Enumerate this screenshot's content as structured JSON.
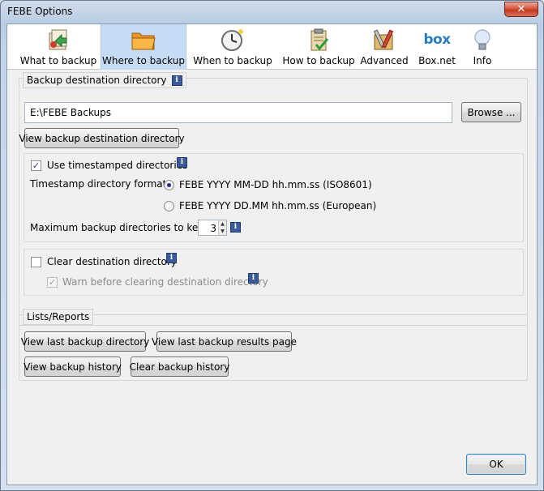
{
  "window": {
    "title": "FEBE Options",
    "close_glyph": "✕"
  },
  "tabs": [
    {
      "label": "What to backup",
      "icon": "backup-arrow-icon"
    },
    {
      "label": "Where to backup",
      "icon": "folder-icon",
      "active": true
    },
    {
      "label": "When to backup",
      "icon": "clock-icon"
    },
    {
      "label": "How to backup",
      "icon": "clipboard-check-icon"
    },
    {
      "label": "Advanced",
      "icon": "tools-icon"
    },
    {
      "label": "Box.net",
      "icon": "box-logo-icon",
      "logo_text": "box"
    },
    {
      "label": "Info",
      "icon": "lightbulb-icon"
    }
  ],
  "destination": {
    "legend": "Backup destination directory",
    "path_value": "E:\\FEBE Backups",
    "browse_label": "Browse ...",
    "view_label": "View backup destination directory",
    "info_glyph": "i"
  },
  "timestamp": {
    "use_label": "Use timestamped directories",
    "use_checked": true,
    "format_label": "Timestamp directory format:",
    "option_iso": "FEBE YYYY MM-DD hh.mm.ss (ISO8601)",
    "option_eu": "FEBE YYYY DD.MM hh.mm.ss (European)",
    "selected": "iso",
    "max_label": "Maximum backup directories to keep:",
    "max_value": "3"
  },
  "clear": {
    "clear_label": "Clear destination directory",
    "clear_checked": false,
    "warn_label": "Warn before clearing destination directory",
    "warn_checked": true,
    "warn_disabled": true
  },
  "lists": {
    "legend": "Lists/Reports",
    "view_last_dir": "View last backup directory",
    "view_last_results": "View last backup results page",
    "view_history": "View backup history",
    "clear_history": "Clear backup history"
  },
  "footer": {
    "ok_label": "OK"
  },
  "colors": {
    "active_tab": "#c6dcf4",
    "info_icon": "#3a5a98"
  }
}
